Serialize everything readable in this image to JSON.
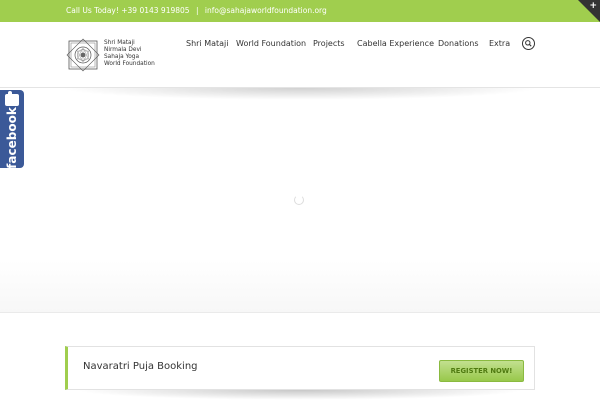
{
  "topbar": {
    "call_text": "Call Us Today! +39 0143 919805",
    "separator": "|",
    "email": "info@sahajaworldfoundation.org",
    "corner_icon": "plus-icon",
    "corner_symbol": "+"
  },
  "logo": {
    "lines": [
      "Shri Mataji",
      "Nirmala Devi",
      "Sahaja Yoga",
      "World Foundation"
    ]
  },
  "nav": {
    "items": [
      "Shri Mataji",
      "World Foundation",
      "Projects",
      "Cabella Experience",
      "Donations",
      "Extra"
    ],
    "search_icon": "search-icon"
  },
  "facebook_tab": {
    "label": "facebook",
    "icon": "thumbs-up-icon"
  },
  "booking": {
    "title": "Navaratri Puja Booking",
    "button_label": "REGISTER NOW!"
  },
  "colors": {
    "accent": "#a0ce4e",
    "facebook": "#3b5998"
  }
}
